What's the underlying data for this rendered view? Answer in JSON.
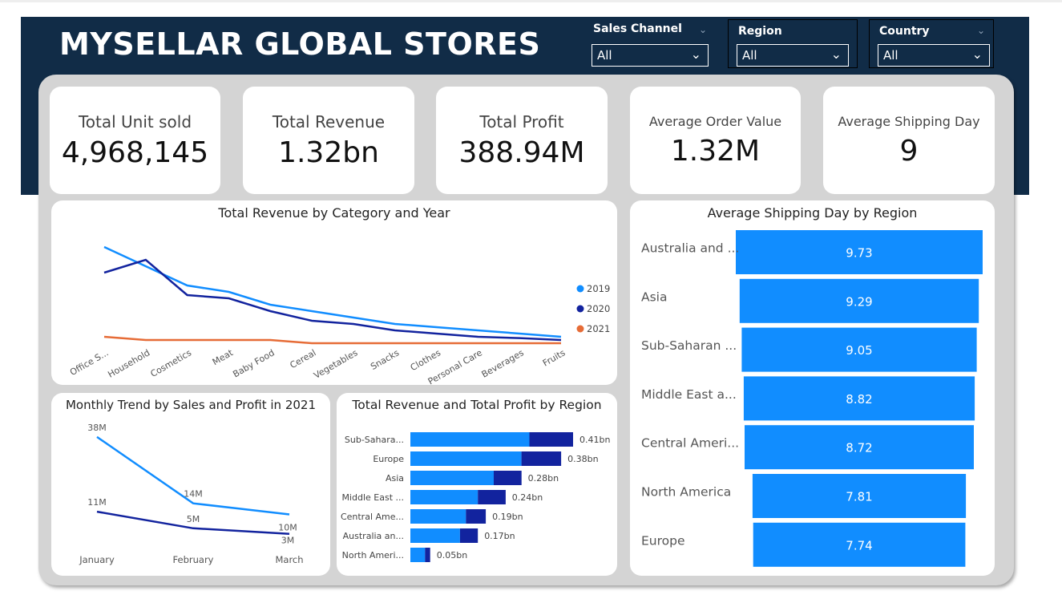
{
  "header": {
    "title": "MYSELLAR GLOBAL STORES",
    "bg_color": "#112c47"
  },
  "slicers": [
    {
      "label": "Sales Channel",
      "value": "All"
    },
    {
      "label": "Region",
      "value": "All"
    },
    {
      "label": "Country",
      "value": "All"
    }
  ],
  "kpis": [
    {
      "label": "Total Unit sold",
      "value": "4,968,145"
    },
    {
      "label": "Total Revenue",
      "value": "1.32bn"
    },
    {
      "label": "Total Profit",
      "value": "388.94M"
    },
    {
      "label": "Average Order Value",
      "value": "1.32M"
    },
    {
      "label": "Average Shipping Day",
      "value": "9"
    }
  ],
  "chart_data": [
    {
      "type": "line",
      "title": "Total Revenue by Category and Year",
      "categories": [
        "Office S...",
        "Household",
        "Cosmetics",
        "Meat",
        "Baby Food",
        "Cereal",
        "Vegetables",
        "Snacks",
        "Clothes",
        "Personal Care",
        "Beverages",
        "Fruits"
      ],
      "series": [
        {
          "name": "2019",
          "color": "#118dff",
          "values": [
            150,
            120,
            90,
            80,
            60,
            50,
            40,
            30,
            25,
            20,
            15,
            10
          ]
        },
        {
          "name": "2020",
          "color": "#12239e",
          "values": [
            110,
            130,
            75,
            70,
            50,
            35,
            30,
            20,
            15,
            10,
            8,
            5
          ]
        },
        {
          "name": "2021",
          "color": "#e66c37",
          "values": [
            10,
            5,
            5,
            5,
            5,
            0,
            0,
            0,
            0,
            0,
            0,
            0
          ]
        }
      ],
      "legend": "right"
    },
    {
      "type": "line",
      "title": "Monthly Trend by Sales and Profit in 2021",
      "categories": [
        "January",
        "February",
        "March"
      ],
      "series": [
        {
          "name": "Sales",
          "color": "#118dff",
          "values": [
            38,
            14,
            10
          ],
          "labels": [
            "38M",
            "14M",
            "10M"
          ]
        },
        {
          "name": "Profit",
          "color": "#12239e",
          "values": [
            11,
            5,
            3
          ],
          "labels": [
            "11M",
            "5M",
            "3M"
          ]
        }
      ]
    },
    {
      "type": "bar",
      "orientation": "horizontal",
      "stacked": true,
      "title": "Total Revenue and Total Profit by Region",
      "categories": [
        "Sub-Sahara...",
        "Europe",
        "Asia",
        "Middle East ...",
        "Central Ame...",
        "Australia an...",
        "North Ameri..."
      ],
      "series": [
        {
          "name": "Total Revenue",
          "color": "#118dff",
          "values": [
            0.3,
            0.28,
            0.21,
            0.17,
            0.14,
            0.125,
            0.037
          ]
        },
        {
          "name": "Total Profit",
          "color": "#12239e",
          "values": [
            0.11,
            0.1,
            0.07,
            0.07,
            0.05,
            0.045,
            0.013
          ]
        }
      ],
      "totals": [
        "0.41bn",
        "0.38bn",
        "0.28bn",
        "0.24bn",
        "0.19bn",
        "0.17bn",
        "0.05bn"
      ]
    },
    {
      "type": "bar",
      "orientation": "funnel",
      "title": "Average Shipping Day by Region",
      "categories": [
        "Australia and ...",
        "Asia",
        "Sub-Saharan ...",
        "Middle East a...",
        "Central Ameri...",
        "North America",
        "Europe"
      ],
      "values": [
        9.73,
        9.29,
        9.05,
        8.82,
        8.72,
        7.81,
        7.74
      ],
      "color": "#118dff"
    }
  ]
}
